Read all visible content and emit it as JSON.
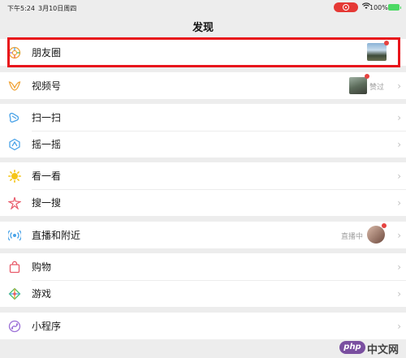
{
  "status_bar": {
    "time": "下午5:24",
    "date": "3月10日周四",
    "battery": "100%"
  },
  "header": {
    "title": "发现"
  },
  "menu": {
    "moments": {
      "label": "朋友圈"
    },
    "channels": {
      "label": "视频号",
      "meta": "赞过"
    },
    "scan": {
      "label": "扫一扫"
    },
    "shake": {
      "label": "摇一摇"
    },
    "top_stories": {
      "label": "看一看"
    },
    "search": {
      "label": "搜一搜"
    },
    "live_nearby": {
      "label": "直播和附近",
      "meta": "直播中"
    },
    "shopping": {
      "label": "购物"
    },
    "games": {
      "label": "游戏"
    },
    "mini_programs": {
      "label": "小程序"
    }
  },
  "colors": {
    "highlight": "#e8141b",
    "badge": "#e64340",
    "background": "#ededed"
  },
  "watermark": {
    "brand": "php",
    "text": "中文网"
  }
}
